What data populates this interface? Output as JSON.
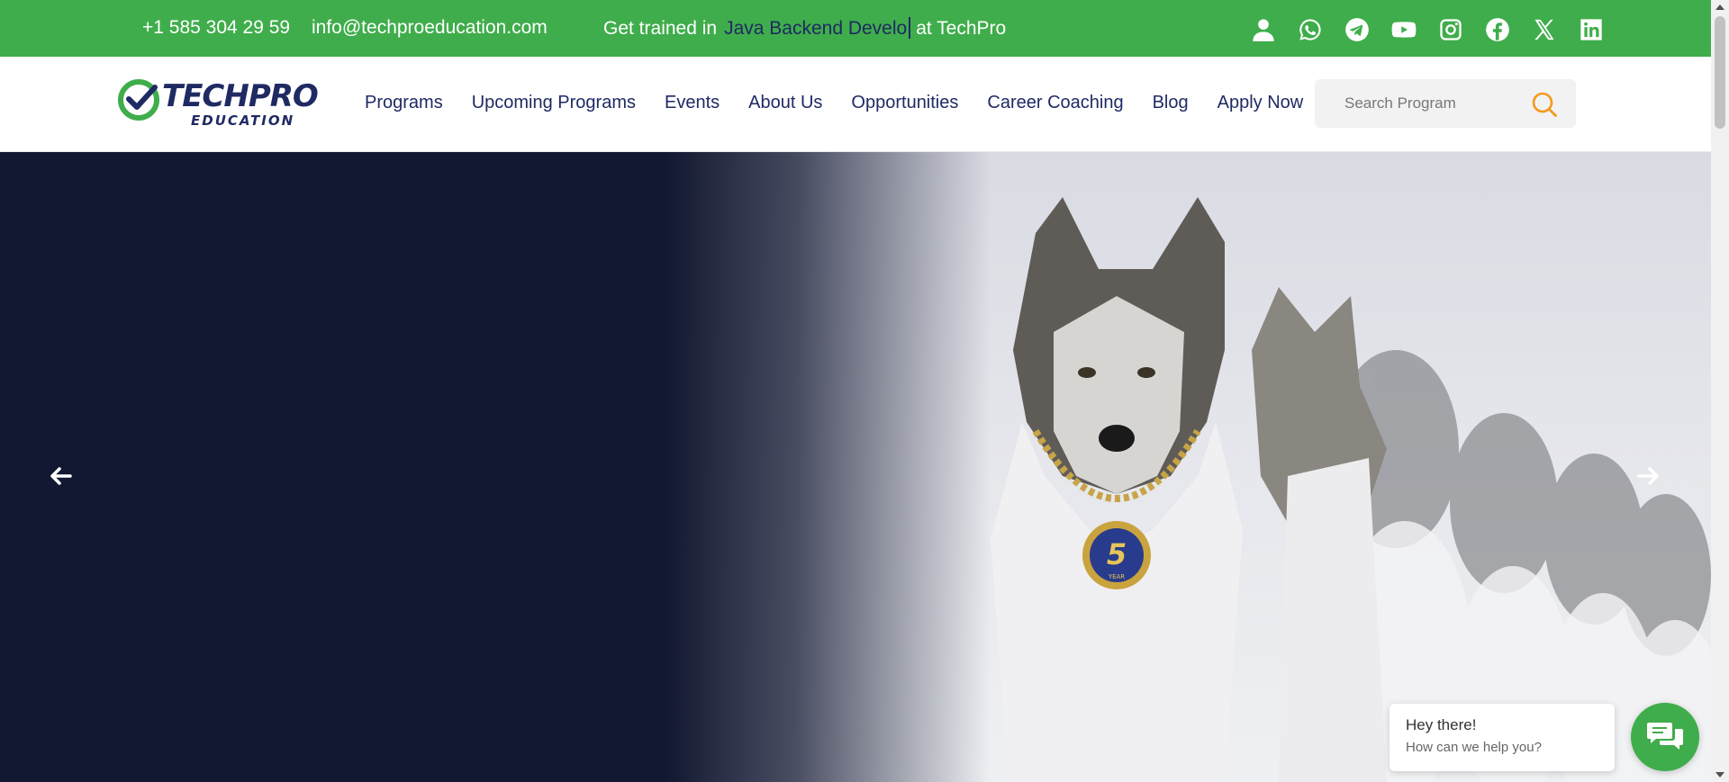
{
  "topbar": {
    "phone": "+1 585 304 29 59",
    "email": "info@techproeducation.com",
    "promo_prefix": "Get trained in",
    "promo_highlight": "Java Backend Develo",
    "promo_suffix": "at TechPro",
    "social_icons": [
      "user-icon",
      "whatsapp-icon",
      "telegram-icon",
      "youtube-icon",
      "instagram-icon",
      "facebook-icon",
      "x-icon",
      "linkedin-icon"
    ]
  },
  "brand": {
    "logo_top": "TECHPRO",
    "logo_bottom": "EDUCATION",
    "green": "#3fad4b",
    "navy": "#1f2a63"
  },
  "nav": {
    "items": [
      "Programs",
      "Upcoming Programs",
      "Events",
      "About Us",
      "Opportunities",
      "Career Coaching",
      "Blog",
      "Apply Now"
    ]
  },
  "search": {
    "placeholder": "Search Program",
    "accent": "#f39a1d"
  },
  "hero": {
    "background": "#131832",
    "medal_text": "5",
    "medal_subtext": "YEAR"
  },
  "chat": {
    "greeting": "Hey there!",
    "prompt": "How can we help you?"
  }
}
